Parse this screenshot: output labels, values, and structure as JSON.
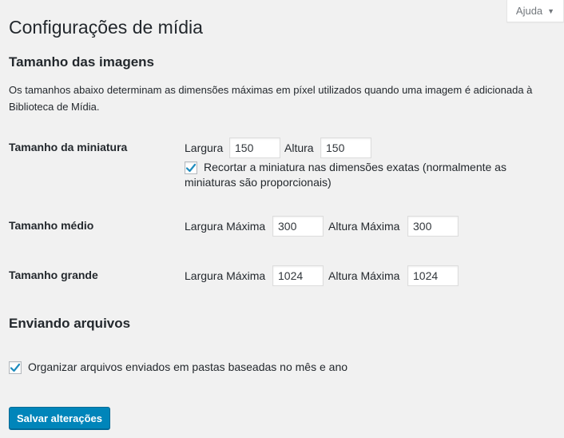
{
  "help_tab": {
    "label": "Ajuda"
  },
  "page_title": "Configurações de mídia",
  "image_sizes": {
    "title": "Tamanho das imagens",
    "description": "Os tamanhos abaixo determinam as dimensões máximas em píxel utilizados quando uma imagem é adicionada à Biblioteca de Mídia.",
    "thumbnail": {
      "label": "Tamanho da miniatura",
      "width_label": "Largura",
      "width_value": "150",
      "height_label": "Altura",
      "height_value": "150",
      "crop_checked": true,
      "crop_label_line1": "Recortar a miniatura nas dimensões exatas (normalmente as",
      "crop_label_line2": "miniaturas são proporcionais)"
    },
    "medium": {
      "label": "Tamanho médio",
      "width_label": "Largura Máxima",
      "width_value": "300",
      "height_label": "Altura Máxima",
      "height_value": "300"
    },
    "large": {
      "label": "Tamanho grande",
      "width_label": "Largura Máxima",
      "width_value": "1024",
      "height_label": "Altura Máxima",
      "height_value": "1024"
    }
  },
  "uploads": {
    "title": "Enviando arquivos",
    "organize_checked": true,
    "organize_label": "Organizar arquivos enviados em pastas baseadas no mês e ano"
  },
  "save_button": {
    "label": "Salvar alterações"
  },
  "colors": {
    "primary": "#0085ba",
    "checkmark": "#1e8cbe",
    "background": "#f1f1f1"
  }
}
